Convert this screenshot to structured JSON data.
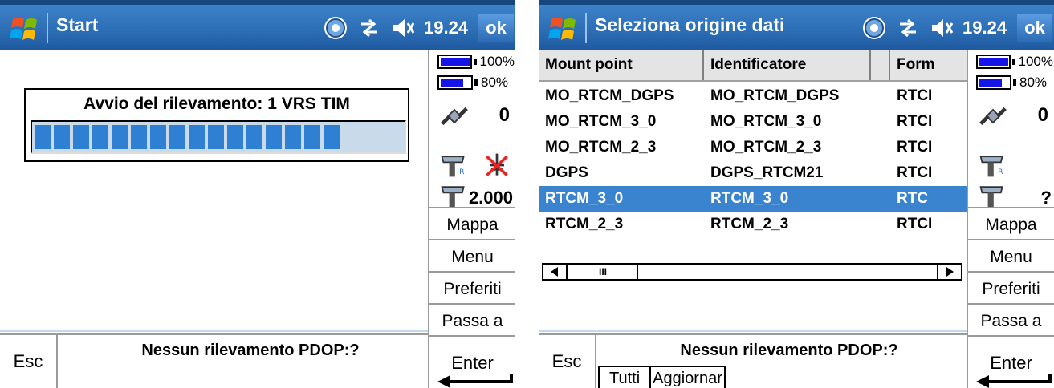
{
  "left_screen": {
    "title": "Start",
    "clock": "19.24",
    "ok_label": "ok",
    "progress_label": "Avvio del rilevamento: 1 VRS TIM",
    "progress_fraction": 0.82,
    "status_text": "Nessun rilevamento  PDOP:?",
    "esc_label": "Esc",
    "side": {
      "battery1_pct": "100%",
      "battery2_pct": "80%",
      "satellites": "0",
      "gps_value": "2.000",
      "buttons": [
        "Mappa",
        "Menu",
        "Preferiti",
        "Passa a"
      ],
      "enter_label": "Enter"
    }
  },
  "right_screen": {
    "title": "Seleziona origine dati",
    "clock": "19.24",
    "ok_label": "ok",
    "columns": [
      "Mount point",
      "Identificatore",
      "Form"
    ],
    "rows": [
      [
        "MO_RTCM_DGPS",
        "MO_RTCM_DGPS",
        "RTCI"
      ],
      [
        "MO_RTCM_3_0",
        "MO_RTCM_3_0",
        "RTCI"
      ],
      [
        "MO_RTCM_2_3",
        "MO_RTCM_2_3",
        "RTCI"
      ],
      [
        "DGPS",
        "DGPS_RTCM21",
        "RTCI"
      ],
      [
        "RTCM_3_0",
        "RTCM_3_0",
        "RTC"
      ],
      [
        "RTCM_2_3",
        "RTCM_2_3",
        "RTCI"
      ]
    ],
    "selected_row": 4,
    "status_text": "Nessun rilevamento  PDOP:?",
    "esc_label": "Esc",
    "tabs": [
      "Tutti",
      "Aggiornar"
    ],
    "side": {
      "battery1_pct": "100%",
      "battery2_pct": "80%",
      "satellites": "0",
      "gps_value": "?",
      "buttons": [
        "Mappa",
        "Menu",
        "Preferiti",
        "Passa a"
      ],
      "enter_label": "Enter"
    }
  },
  "colors": {
    "titlebar": "#2d6fb6",
    "selection": "#3a84cf",
    "progress_fill": "#2f7fd3",
    "battery_fill": "#1515e8"
  }
}
